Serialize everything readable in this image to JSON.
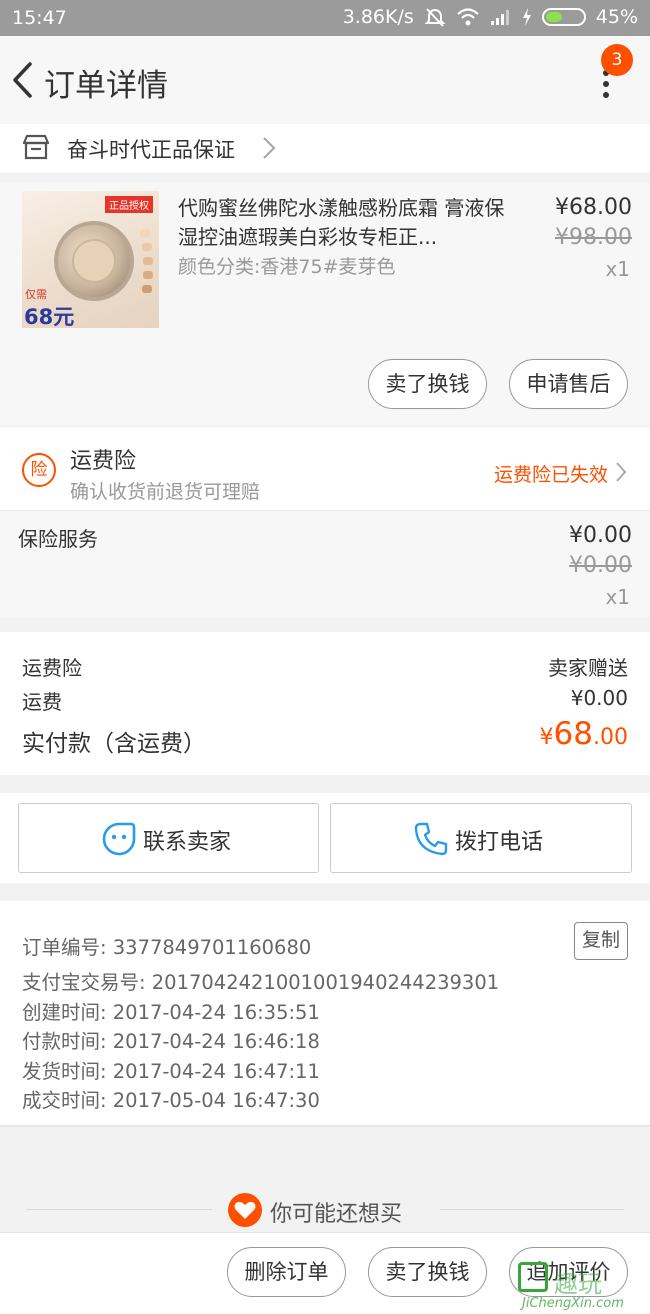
{
  "status_bar": {
    "time": "15:47",
    "network_speed": "3.86K/s",
    "battery": "45%",
    "battery_level": 0.45
  },
  "header": {
    "title": "订单详情",
    "badge_count": "3"
  },
  "shop": {
    "name": "奋斗时代正品保证"
  },
  "product": {
    "title": "代购蜜丝佛陀水漾触感粉底霜 膏液保湿控油遮瑕美白彩妆专柜正...",
    "sku": "颜色分类:香港75#麦芽色",
    "price_now": "¥68.00",
    "price_original": "¥98.00",
    "quantity": "x1",
    "image": {
      "tag": "正品授权",
      "prefix": "仅需",
      "price": "68元"
    },
    "actions": {
      "sell": "卖了换钱",
      "after_sale": "申请售后"
    }
  },
  "shipping_insurance": {
    "icon_text": "险",
    "title": "运费险",
    "subtitle": "确认收货前退货可理赔",
    "status": "运费险已失效"
  },
  "insurance_service": {
    "label": "保险服务",
    "price": "¥0.00",
    "price_original": "¥0.00",
    "quantity": "x1"
  },
  "summary": {
    "insurance_label": "运费险",
    "insurance_value": "卖家赠送",
    "shipping_label": "运费",
    "shipping_value": "¥0.00",
    "total_label": "实付款（含运费）",
    "total_currency": "¥",
    "total_int": "68",
    "total_dec": ".00"
  },
  "contact": {
    "seller": "联系卖家",
    "call": "拨打电话"
  },
  "order_info": {
    "order_no": "订单编号: 3377849701160680",
    "copy": "复制",
    "alipay_no": "支付宝交易号: 2017042421001001940244239301",
    "created": "创建时间: 2017-04-24 16:35:51",
    "paid": "付款时间: 2017-04-24 16:46:18",
    "shipped": "发货时间: 2017-04-24 16:47:11",
    "completed": "成交时间: 2017-05-04 16:47:30"
  },
  "recommend": {
    "title": "你可能还想买"
  },
  "bottom_bar": {
    "delete": "删除订单",
    "sell": "卖了换钱",
    "review": "追加评价"
  },
  "watermark": {
    "site": "JiChengXin.com",
    "brand": "趣玩"
  },
  "colors": {
    "accent": "#ff5000",
    "status_bar": "#9b9b9b",
    "contact_icon": "#2a9be8"
  }
}
